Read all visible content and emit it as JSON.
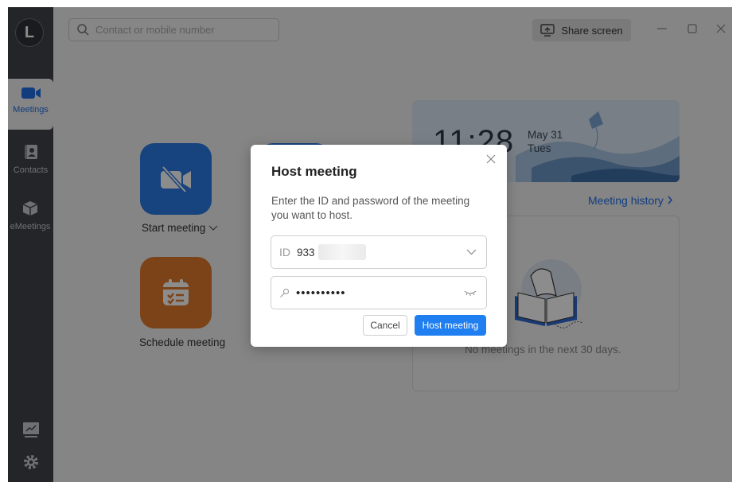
{
  "sidebar": {
    "logo_letter": "L",
    "items": [
      {
        "label": "Meetings",
        "icon": "video-camera-icon",
        "active": true
      },
      {
        "label": "Contacts",
        "icon": "contact-card-icon",
        "active": false
      },
      {
        "label": "eMeetings",
        "icon": "cube-icon",
        "active": false
      }
    ],
    "bottom_icons": [
      "presentation-chart-icon",
      "gear-icon"
    ]
  },
  "topbar": {
    "search_placeholder": "Contact or mobile number",
    "share_screen_label": "Share screen"
  },
  "main": {
    "start_meeting_label": "Start meeting",
    "schedule_meeting_label": "Schedule meeting",
    "banner": {
      "time": "11:28",
      "month_day": "May 31",
      "weekday": "Tues"
    },
    "meeting_history_label": "Meeting history",
    "empty_text": "No meetings in the next 30 days."
  },
  "dialog": {
    "title": "Host meeting",
    "description": "Enter the ID and password of the meeting you want to host.",
    "id_prefix": "ID",
    "id_value": "933",
    "password_mask": "••••••••••",
    "cancel_label": "Cancel",
    "host_label": "Host meeting"
  },
  "colors": {
    "accent": "#1f7ef0",
    "sidebar": "#40444b",
    "tile_blue": "#2a7be6",
    "tile_orange": "#e07a2a"
  }
}
